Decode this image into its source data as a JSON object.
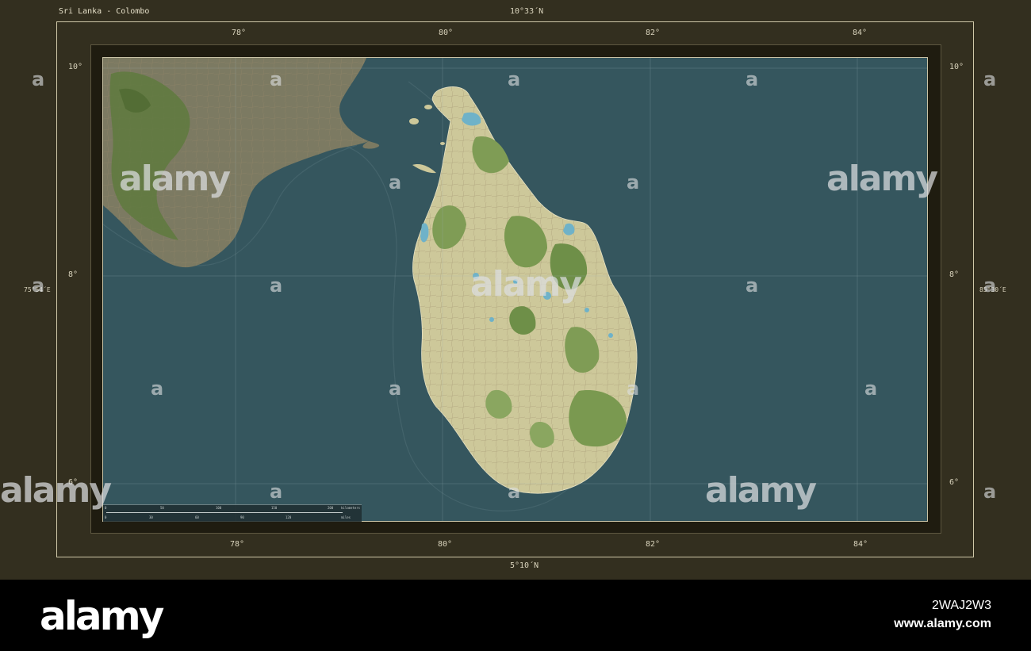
{
  "map": {
    "title": "Sri Lanka - Colombo",
    "lat_top": "10°33´N",
    "lat_bottom": "5°10´N",
    "lon_left": "75°54´E",
    "lon_right": "85°30´E",
    "lon_ticks": [
      "78°",
      "80°",
      "82°",
      "84°"
    ],
    "lat_ticks": [
      "10°",
      "8°",
      "6°"
    ]
  },
  "scale": {
    "km_ticks": [
      "0",
      "50",
      "100",
      "150",
      "200"
    ],
    "km_unit": "kilometers",
    "mi_ticks": [
      "0",
      "30",
      "60",
      "90",
      "120"
    ],
    "mi_unit": "miles"
  },
  "watermark": {
    "brand": "alamy",
    "glyph": "a",
    "image_id": "2WAJ2W3",
    "site": "www.alamy.com"
  },
  "colors": {
    "sea": "#35565e",
    "land_lowland": "#cdc89a",
    "forest": "#6d8f4a",
    "mainland_india": "#7c7a62",
    "frame": "#332f1f"
  }
}
